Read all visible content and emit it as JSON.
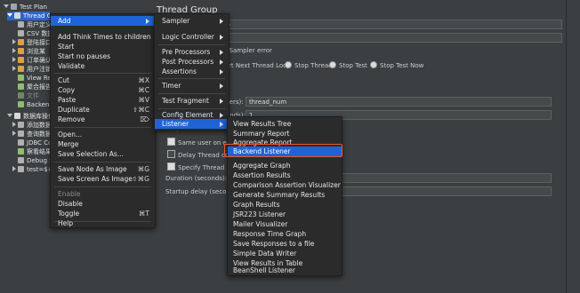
{
  "tree": {
    "items": [
      {
        "label": "Test Plan",
        "color": "#9aa7b0",
        "tri": "down"
      },
      {
        "label": "Thread Gr",
        "color": "#7aa6e0",
        "tri": "down",
        "selected": true
      },
      {
        "label": "用户定义的",
        "color": "#b0b0b0"
      },
      {
        "label": "CSV 数据",
        "color": "#b0b0b0"
      },
      {
        "label": "登陆接口",
        "color": "#e0a040",
        "tri": "right"
      },
      {
        "label": "浏览某",
        "color": "#e0a040",
        "tri": "right"
      },
      {
        "label": "订单确认",
        "color": "#e0a040",
        "tri": "right"
      },
      {
        "label": "用户注销",
        "color": "#e0a040",
        "tri": "right"
      },
      {
        "label": "View Res",
        "color": "#8fbf6a"
      },
      {
        "label": "聚合报告",
        "color": "#8fbf6a"
      },
      {
        "label": "文件",
        "color": "#8fbf6a"
      },
      {
        "label": "Backend",
        "color": "#8fbf6a"
      },
      {
        "label": "数据库操作",
        "color": "#7aa6e0",
        "tri": "down"
      },
      {
        "label": "添加数据",
        "color": "#b0b0b0"
      },
      {
        "label": "查询数据",
        "color": "#b0b0b0"
      },
      {
        "label": "JDBC Con",
        "color": "#b0b0b0"
      },
      {
        "label": "察看结果",
        "color": "#8fbf6a"
      },
      {
        "label": "Debug Sa",
        "color": "#b0b0b0"
      },
      {
        "label": "test=${r",
        "color": "#b0b0b0"
      }
    ]
  },
  "panel": {
    "title": "Thread Group",
    "name_value": "up",
    "error_action": "r a Sampler error",
    "radio_options": [
      "rt Next Thread Loop",
      "Stop Thread",
      "Stop Test",
      "Stop Test Now"
    ],
    "users_label": "sers):",
    "users_value": "thread_num",
    "ramp_label": "onds):",
    "ramp_value": "1",
    "loop_label": "Loop Count:",
    "same_user_label": "Same user on eac",
    "delay_label": "Delay Thread cre",
    "specify_label": "Specify Thread lif",
    "duration_label": "Duration (seconds):",
    "startup_label": "Startup delay (secon"
  },
  "menu1": {
    "add": "Add",
    "add_think": "Add Think Times to children",
    "start": "Start",
    "start_no_pauses": "Start no pauses",
    "validate": "Validate",
    "cut": "Cut",
    "cut_sc": "⌘X",
    "copy": "Copy",
    "copy_sc": "⌘C",
    "paste": "Paste",
    "paste_sc": "⌘V",
    "duplicate": "Duplicate",
    "duplicate_sc": "⇧⌘C",
    "remove": "Remove",
    "remove_sc": "⌦",
    "open": "Open...",
    "merge": "Merge",
    "save_selection": "Save Selection As...",
    "save_node_image": "Save Node As Image",
    "save_node_image_sc": "⌘G",
    "save_screen_image": "Save Screen As Image",
    "save_screen_image_sc": "⇧⌘G",
    "enable": "Enable",
    "disable": "Disable",
    "toggle": "Toggle",
    "toggle_sc": "⌘T",
    "help": "Help"
  },
  "menu2": {
    "sampler": "Sampler",
    "logic_controller": "Logic Controller",
    "pre_processors": "Pre Processors",
    "post_processors": "Post Processors",
    "assertions": "Assertions",
    "timer": "Timer",
    "test_fragment": "Test Fragment",
    "config_element": "Config Element",
    "listener": "Listener"
  },
  "menu3": {
    "items": [
      "View Results Tree",
      "Summary Report",
      "Aggregate Report",
      "Backend Listener",
      "Aggregate Graph",
      "Assertion Results",
      "Comparison Assertion Visualizer",
      "Generate Summary Results",
      "Graph Results",
      "JSR223 Listener",
      "Mailer Visualizer",
      "Response Time Graph",
      "Save Responses to a file",
      "Simple Data Writer",
      "View Results in Table",
      "BeanShell Listener"
    ]
  },
  "colors": {
    "highlight": "#1f64d6",
    "callout": "#e8562a"
  }
}
